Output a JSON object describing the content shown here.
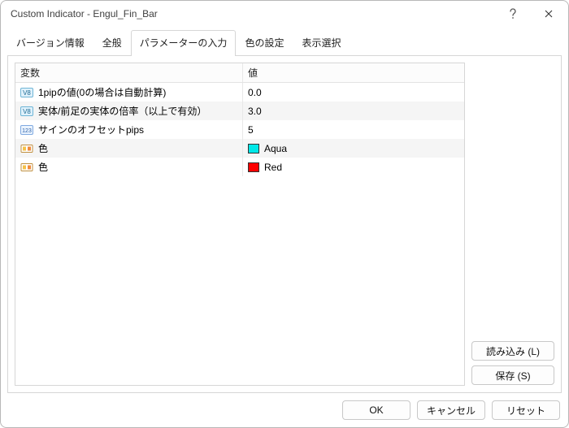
{
  "window": {
    "title": "Custom Indicator - Engul_Fin_Bar"
  },
  "tabs": {
    "items": [
      {
        "label": "バージョン情報"
      },
      {
        "label": "全般"
      },
      {
        "label": "パラメーターの入力",
        "active": true
      },
      {
        "label": "色の設定"
      },
      {
        "label": "表示選択"
      }
    ]
  },
  "table": {
    "headers": {
      "var": "変数",
      "val": "値"
    },
    "rows": [
      {
        "icon": "val",
        "var": "1pipの値(0の場合は自動計算)",
        "val": "0.0"
      },
      {
        "icon": "val",
        "var": "実体/前足の実体の倍率（以上で有効）",
        "val": "3.0"
      },
      {
        "icon": "int",
        "var": "サインのオフセットpips",
        "val": "5"
      },
      {
        "icon": "color",
        "var": "色",
        "val": "Aqua",
        "swatch": "#00e8e8"
      },
      {
        "icon": "color",
        "var": "色",
        "val": "Red",
        "swatch": "#ff0000"
      }
    ]
  },
  "side": {
    "load": "読み込み (L)",
    "save": "保存 (S)"
  },
  "footer": {
    "ok": "OK",
    "cancel": "キャンセル",
    "reset": "リセット"
  }
}
